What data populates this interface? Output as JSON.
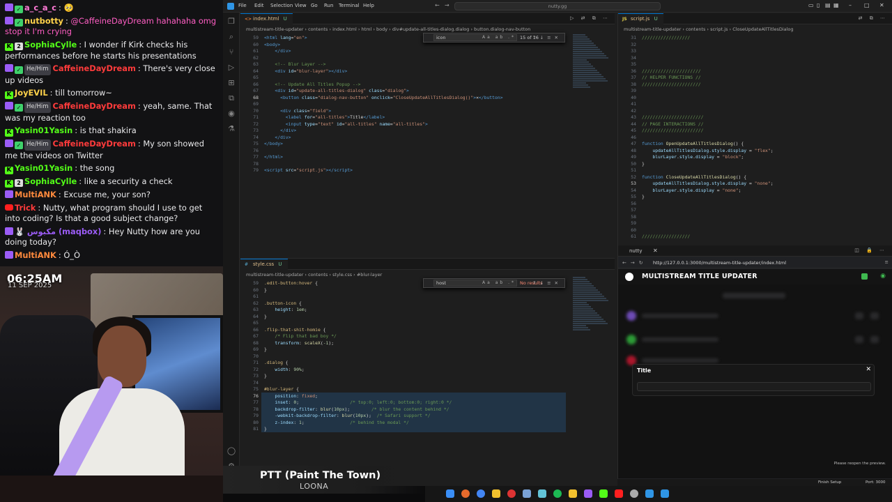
{
  "chat": {
    "messages": [
      {
        "badges": [
          "purple",
          "green-check"
        ],
        "user": "a_c_a_c",
        "user_color": "#ff7ad6",
        "text": "",
        "extra": "🥺"
      },
      {
        "badges": [
          "purple",
          "green-check"
        ],
        "user": "nutbotty",
        "user_color": "#ffd24a",
        "text": "@CaffeineDayDream hahahaha omg stop it I'm crying",
        "text_color": "#ff5ec4"
      },
      {
        "badges": [
          "k",
          "num2"
        ],
        "user": "SophiaCylle",
        "user_color": "#53fc18",
        "text": "I wonder if Kirk checks his performances before he starts his presentations"
      },
      {
        "badges": [
          "purple",
          "green-check"
        ],
        "hehim": "He/Him",
        "user": "CaffeineDayDream",
        "user_color": "#ff3b3b",
        "text": "There's very close up videos"
      },
      {
        "badges": [
          "k"
        ],
        "user": "JoyEVIL",
        "user_color": "#ffd24a",
        "text": "till tomorrow~"
      },
      {
        "badges": [
          "purple",
          "green-check"
        ],
        "hehim": "He/Him",
        "user": "CaffeineDayDream",
        "user_color": "#ff3b3b",
        "text": "yeah, same. That was my reaction too"
      },
      {
        "badges": [
          "k"
        ],
        "user": "Yasin01Yasin",
        "user_color": "#53fc18",
        "text": "is that shakira"
      },
      {
        "badges": [
          "purple",
          "green-check"
        ],
        "hehim": "He/Him",
        "user": "CaffeineDayDream",
        "user_color": "#ff3b3b",
        "text": "My son showed me the videos on Twitter"
      },
      {
        "badges": [
          "k"
        ],
        "user": "Yasin01Yasin",
        "user_color": "#53fc18",
        "text": "the song"
      },
      {
        "badges": [
          "k",
          "num2"
        ],
        "user": "SophiaCylle",
        "user_color": "#53fc18",
        "text": "like a security a check"
      },
      {
        "badges": [
          "purple"
        ],
        "user": "MultiANK",
        "user_color": "#ff8a3d",
        "text": "Excuse me, your son?"
      },
      {
        "badges": [
          "yt"
        ],
        "user": "Trick",
        "user_color": "#ff3b3b",
        "text": "Nutty, what program should I use to get into coding? Is that a good subject change?"
      },
      {
        "badges": [
          "purple"
        ],
        "user": "مكبوس (maqbox)",
        "user_color": "#9b5cf6",
        "prefix": "🐰",
        "text": "Hey Nutty how are you doing today?"
      },
      {
        "badges": [
          "purple"
        ],
        "user": "MultiANK",
        "user_color": "#ff8a3d",
        "text": "Ó_Ò"
      }
    ]
  },
  "stream": {
    "time": "06:25AM",
    "date": "11 SEP 2025",
    "now_playing": {
      "song": "PTT (Paint The Town)",
      "artist": "LOONA"
    }
  },
  "vscode": {
    "menu": [
      "File",
      "Edit",
      "Selection",
      "View",
      "Go",
      "Run",
      "Terminal",
      "Help"
    ],
    "search_placeholder": "nutty.gg",
    "html_pane": {
      "tab": "index.html",
      "tab_flag": "U",
      "breadcrumbs": "multistream-title-updater  ›  contents  ›  index.html  ›  html  ›  body  ›  div#update-all-titles-dialog.dialog  ›  button.dialog-nav-button",
      "find_query": "icon",
      "find_count": "15 of 16",
      "lines": [
        {
          "n": "59",
          "html": "<span class='tk-tag'>&lt;html</span> <span class='tk-attr'>lang</span>=<span class='tk-str'>\"en\"</span><span class='tk-tag'>&gt;</span>"
        },
        {
          "n": "60",
          "html": "<span class='tk-tag'>&lt;body&gt;</span>"
        },
        {
          "n": "61",
          "html": "    <span class='tk-tag'>&lt;/div&gt;</span>"
        },
        {
          "n": "62",
          "html": ""
        },
        {
          "n": "63",
          "html": "    <span class='tk-com'>&lt;!-- Blur Layer --&gt;</span>"
        },
        {
          "n": "64",
          "html": "    <span class='tk-tag'>&lt;div</span> <span class='tk-attr'>id</span>=<span class='tk-str'>\"blur-layer\"</span><span class='tk-tag'>&gt;&lt;/div&gt;</span>"
        },
        {
          "n": "65",
          "html": ""
        },
        {
          "n": "66",
          "html": "    <span class='tk-com'>&lt;!-- Update All Titles Popup --&gt;</span>"
        },
        {
          "n": "67",
          "html": "    <span class='tk-tag'>&lt;div</span> <span class='tk-attr'>id</span>=<span class='tk-str'>\"update-all-titles-dialog\"</span> <span class='tk-attr'>class</span>=<span class='tk-str'>\"dialog\"</span><span class='tk-tag'>&gt;</span>"
        },
        {
          "n": "68",
          "html": "      <span class='tk-tag'>&lt;button</span> <span class='tk-attr'>class</span>=<span class='tk-str'>\"dialog-nav-button\"</span> <span class='tk-attr'>onclick</span>=<span class='tk-str'>\"CloseUpdateAllTitlesDialog()\"</span><span class='tk-tag'>&gt;</span>✕<span class='tk-tag'>&lt;/button&gt;</span>"
        },
        {
          "n": "69",
          "html": ""
        },
        {
          "n": "70",
          "html": "      <span class='tk-tag'>&lt;div</span> <span class='tk-attr'>class</span>=<span class='tk-str'>\"field\"</span><span class='tk-tag'>&gt;</span>"
        },
        {
          "n": "71",
          "html": "        <span class='tk-tag'>&lt;label</span> <span class='tk-attr'>for</span>=<span class='tk-str'>\"all-titles\"</span><span class='tk-tag'>&gt;</span>Title<span class='tk-tag'>&lt;/label&gt;</span>"
        },
        {
          "n": "72",
          "html": "        <span class='tk-tag'>&lt;input</span> <span class='tk-attr'>type</span>=<span class='tk-str'>\"text\"</span> <span class='tk-attr'>id</span>=<span class='tk-str'>\"all-titles\"</span> <span class='tk-attr'>name</span>=<span class='tk-str'>\"all-titles\"</span><span class='tk-tag'>&gt;</span>"
        },
        {
          "n": "73",
          "html": "      <span class='tk-tag'>&lt;/div&gt;</span>"
        },
        {
          "n": "74",
          "html": "    <span class='tk-tag'>&lt;/div&gt;</span>"
        },
        {
          "n": "75",
          "html": "<span class='tk-tag'>&lt;/body&gt;</span>"
        },
        {
          "n": "76",
          "html": ""
        },
        {
          "n": "77",
          "html": "<span class='tk-tag'>&lt;/html&gt;</span>"
        },
        {
          "n": "78",
          "html": ""
        },
        {
          "n": "79",
          "html": "<span class='tk-tag'>&lt;script</span> <span class='tk-attr'>src</span>=<span class='tk-str'>\"script.js\"</span><span class='tk-tag'>&gt;&lt;/script&gt;</span>"
        }
      ]
    },
    "js_pane": {
      "tab": "script.js",
      "tab_flag": "U",
      "breadcrumbs": "multistream-title-updater  ›  contents  ›  script.js  ›  CloseUpdateAllTitlesDialog",
      "lines": [
        {
          "n": "31",
          "html": "<span class='tk-com'>//////////////////</span>"
        },
        {
          "n": "32",
          "html": ""
        },
        {
          "n": "33",
          "html": ""
        },
        {
          "n": "34",
          "html": ""
        },
        {
          "n": "35",
          "html": ""
        },
        {
          "n": "36",
          "html": "<span class='tk-com'>//////////////////////</span>"
        },
        {
          "n": "37",
          "html": "<span class='tk-com'>// HELPER FUNCTIONS //</span>"
        },
        {
          "n": "38",
          "html": "<span class='tk-com'>//////////////////////</span>"
        },
        {
          "n": "39",
          "html": ""
        },
        {
          "n": "40",
          "html": ""
        },
        {
          "n": "41",
          "html": ""
        },
        {
          "n": "42",
          "html": ""
        },
        {
          "n": "43",
          "html": "<span class='tk-com'>///////////////////////</span>"
        },
        {
          "n": "44",
          "html": "<span class='tk-com'>// PAGE INTERACTIONS //</span>"
        },
        {
          "n": "45",
          "html": "<span class='tk-com'>///////////////////////</span>"
        },
        {
          "n": "46",
          "html": ""
        },
        {
          "n": "47",
          "html": "<span class='tk-kw'>function</span> <span class='tk-fn'>OpenUpdateAllTitlesDialog</span>() {"
        },
        {
          "n": "48",
          "html": "    <span class='tk-prop'>updateAllTitlesDialog</span>.<span class='tk-prop'>style</span>.<span class='tk-prop'>display</span> = <span class='tk-str'>\"flex\"</span>;"
        },
        {
          "n": "49",
          "html": "    <span class='tk-prop'>blurLayer</span>.<span class='tk-prop'>style</span>.<span class='tk-prop'>display</span> = <span class='tk-str'>\"block\"</span>;"
        },
        {
          "n": "50",
          "html": "}"
        },
        {
          "n": "51",
          "html": ""
        },
        {
          "n": "52",
          "html": "<span class='tk-kw'>function</span> <span class='tk-fn'>CloseUpdateAllTitlesDialog</span>() {"
        },
        {
          "n": "53",
          "html": "    <span class='tk-prop'>updateAllTitlesDialog</span>.<span class='tk-prop'>style</span>.<span class='tk-prop'>display</span> = <span class='tk-str'>\"none\"</span>;"
        },
        {
          "n": "54",
          "html": "    <span class='tk-prop'>blurLayer</span>.<span class='tk-prop'>style</span>.<span class='tk-prop'>display</span> = <span class='tk-str'>\"none\"</span>;"
        },
        {
          "n": "55",
          "html": "}"
        },
        {
          "n": "56",
          "html": ""
        },
        {
          "n": "57",
          "html": ""
        },
        {
          "n": "58",
          "html": ""
        },
        {
          "n": "59",
          "html": ""
        },
        {
          "n": "60",
          "html": ""
        },
        {
          "n": "61",
          "html": "<span class='tk-com'>//////////////////</span>"
        }
      ]
    },
    "css_pane": {
      "tab": "style.css",
      "tab_flag": "U",
      "breadcrumbs": "multistream-title-updater  ›  contents  ›  style.css  ›  #blur-layer",
      "find_query": "host",
      "find_count": "No results",
      "lines": [
        {
          "n": "59",
          "html": "<span class='tk-sel'>.edit-button:hover</span> {"
        },
        {
          "n": "60",
          "html": "}"
        },
        {
          "n": "61",
          "html": ""
        },
        {
          "n": "62",
          "html": "<span class='tk-sel'>.button-icon</span> {"
        },
        {
          "n": "63",
          "html": "    <span class='tk-prop'>height</span>: <span class='tk-num'>1em</span>;"
        },
        {
          "n": "64",
          "html": "}"
        },
        {
          "n": "65",
          "html": ""
        },
        {
          "n": "66",
          "html": "<span class='tk-sel'>.flip-that-shit-homie</span> {"
        },
        {
          "n": "67",
          "html": "    <span class='tk-com'>/* Flip that bad boy */</span>"
        },
        {
          "n": "68",
          "html": "    <span class='tk-prop'>transform</span>: <span class='tk-fn'>scaleX</span>(<span class='tk-num'>-1</span>);"
        },
        {
          "n": "69",
          "html": "}"
        },
        {
          "n": "70",
          "html": ""
        },
        {
          "n": "71",
          "html": "<span class='tk-sel'>.dialog</span> {"
        },
        {
          "n": "72",
          "html": "    <span class='tk-prop'>width</span>: <span class='tk-num'>90%</span>;"
        },
        {
          "n": "73",
          "html": "}"
        },
        {
          "n": "74",
          "html": ""
        },
        {
          "n": "75",
          "html": "<span class='tk-sel'>#blur-layer</span> {"
        },
        {
          "n": "76",
          "html": "    <span class='tk-prop'>position</span>: <span class='tk-str'>fixed</span>;"
        },
        {
          "n": "77",
          "html": "    <span class='tk-prop'>inset</span>: <span class='tk-num'>0</span>;                   <span class='tk-com'>/* top:0; left:0; bottom:0; right:0 */</span>"
        },
        {
          "n": "78",
          "html": "    <span class='tk-prop'>backdrop-filter</span>: <span class='tk-fn'>blur</span>(<span class='tk-num'>10px</span>);        <span class='tk-com'>/* blur the content behind */</span>"
        },
        {
          "n": "79",
          "html": "    <span class='tk-prop'>-webkit-backdrop-filter</span>: <span class='tk-fn'>blur</span>(<span class='tk-num'>10px</span>);  <span class='tk-com'>/* Safari support */</span>"
        },
        {
          "n": "80",
          "html": "    <span class='tk-prop'>z-index</span>: <span class='tk-num'>1</span>;                 <span class='tk-com'>/* behind the modal */</span>"
        },
        {
          "n": "81",
          "html": "}"
        }
      ]
    },
    "preview": {
      "tab": "nutty",
      "url": "http://127.0.0.1:3000/multistream-title-updater/index.html",
      "site_title": "MULTISTREAM TITLE UPDATER",
      "dialog_label": "Title",
      "dialog_close": "✕",
      "reopen_text": "Please reopen the preview."
    },
    "statusbar": {
      "finish_setup": "Finish Setup",
      "port": "Port: 3000"
    }
  }
}
